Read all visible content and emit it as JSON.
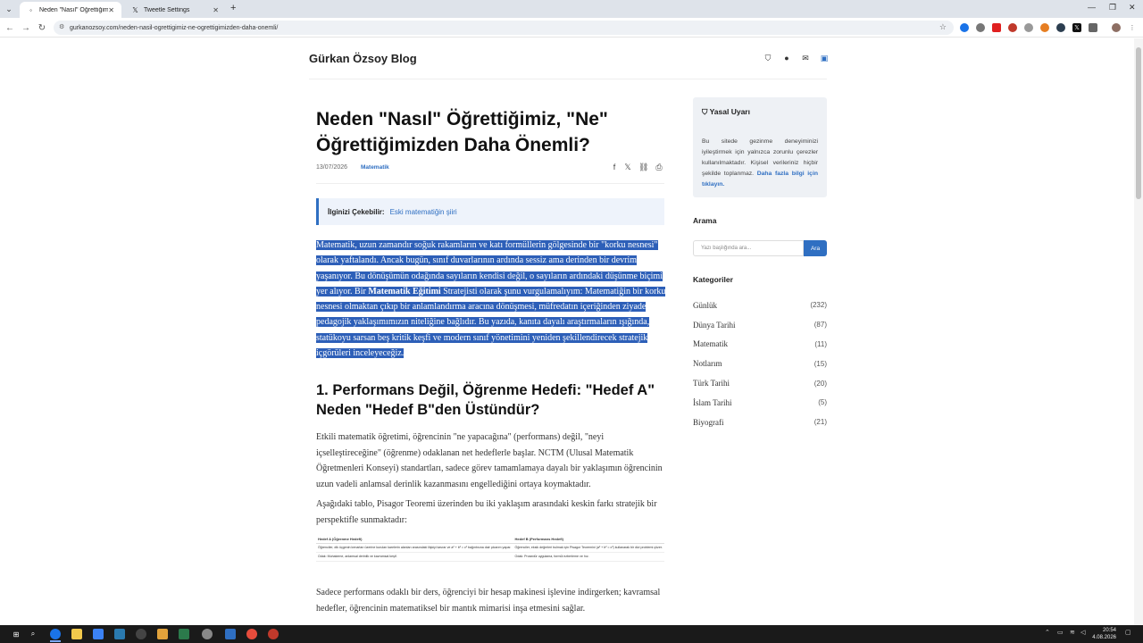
{
  "browser": {
    "tabs": [
      {
        "label": "Neden \"Nasıl\" Öğrettiğimiz, \"Ne\"...",
        "active": true
      },
      {
        "label": "Tweetle Settings",
        "active": false
      }
    ],
    "url": "gurkanozsoy.com/neden-nasil-ogrettigimiz-ne-ogrettigimizden-daha-onemli/"
  },
  "site": {
    "title": "Gürkan Özsoy Blog"
  },
  "article": {
    "title": "Neden \"Nasıl\" Öğrettiğimiz, \"Ne\" Öğrettiğimizden Daha Önemli?",
    "date": "13/07/2026",
    "category": "Matematik",
    "related_label": "İlginizi Çekebilir:",
    "related_link": "Eski matematiğin şiiri",
    "intro_part1": "Matematik, uzun zamandır soğuk rakamların ve katı formüllerin gölgesinde bir \"korku nesnesi\" olarak yaftalandı. Ancak bugün, sınıf duvarlarının ardında sessiz ama derinden bir devrim yaşanıyor. Bu dönüşümün odağında sayıların kendisi değil, o sayıların ardındaki düşünme biçimi yer alıyor. Bir ",
    "intro_bold": "Matematik Eğitimi",
    "intro_part2": " Stratejisti olarak şunu vurgulamalıyım: Matematiğin bir korku nesnesi olmaktan çıkıp bir anlamlandırma aracına dönüşmesi, müfredatın içeriğinden ziyade pedagojik yaklaşımımızın niteliğine bağlıdır. Bu yazıda, kanıta dayalı araştırmaların ışığında, statükoyu sarsan beş kritik keşfi ve modern sınıf yönetimini yeniden şekillendirecek stratejik içgörüleri inceleyeceğiz.",
    "h2": "1. Performans Değil, Öğrenme Hedefi: \"Hedef A\" Neden \"Hedef B\"den Üstündür?",
    "para1": "Etkili matematik öğretimi, öğrencinin \"ne yapacağına\" (performans) değil, \"neyi içselleştireceğine\" (öğrenme) odaklanan net hedeflerle başlar. NCTM (Ulusal Matematik Öğretmenleri Konseyi) standartları, sadece görev tamamlamaya dayalı bir yaklaşımın öğrencinin uzun vadeli anlamsal derinlik kazanmasını engellediğini ortaya koymaktadır.",
    "para2": "Aşağıdaki tablo, Pisagor Teoremi üzerinden bu iki yaklaşım arasındaki keskin farkı stratejik bir perspektifle sunmaktadır:",
    "para3": "Sadece performans odaklı bir ders, öğrenciyi bir hesap makinesi işlevine indirgerken; kavramsal hedefler, öğrencinin matematiksel bir mantık mimarisi inşa etmesini sağlar.",
    "table": {
      "headers": [
        "Hedef A (Öğrenme Hedefi)",
        "Hedef B (Performans Hedefi)"
      ],
      "rows": [
        [
          "Öğrenciler, dik üçgenin kenarları üzerine kurulan karelerin alanları arasındaki ilişkiyi kavrar ve a² + b² = c² bağıntısına dair çıkarım yapar.",
          "Öğrenciler, eksik değerleri bulmak için Pisagor Teoremini (a² + b² = c²) kullanarak bir dizi problemi çözer."
        ],
        [
          "Odak: Muhakeme, anlamsal derinlik ve kavramsal keşif.",
          "Odak: Prosedür uygulama, formül ezberleme ve hız."
        ]
      ]
    }
  },
  "sidebar": {
    "legal_title": "Yasal Uyarı",
    "legal_text": "Bu sitede gezinme deneyiminizi iyileştirmek için yalnızca zorunlu çerezler kullanılmaktadır. Kişisel verileriniz hiçbir şekilde toplanmaz.",
    "legal_link": "Daha fazla bilgi için tıklayın.",
    "search_title": "Arama",
    "search_placeholder": "Yazı başlığında ara...",
    "search_button": "Ara",
    "categories_title": "Kategoriler",
    "categories": [
      {
        "name": "Günlük",
        "count": "(232)"
      },
      {
        "name": "Dünya Tarihi",
        "count": "(87)"
      },
      {
        "name": "Matematik",
        "count": "(11)"
      },
      {
        "name": "Notlarım",
        "count": "(15)"
      },
      {
        "name": "Türk Tarihi",
        "count": "(20)"
      },
      {
        "name": "İslam Tarihi",
        "count": "(5)"
      },
      {
        "name": "Biyografi",
        "count": "(21)"
      }
    ]
  },
  "taskbar": {
    "time": "20:54",
    "date": "4.08.2026"
  },
  "colors": {
    "accent": "#2f6fc2",
    "selection": "#2d5fb8",
    "legal_bg": "#eef1f5"
  }
}
